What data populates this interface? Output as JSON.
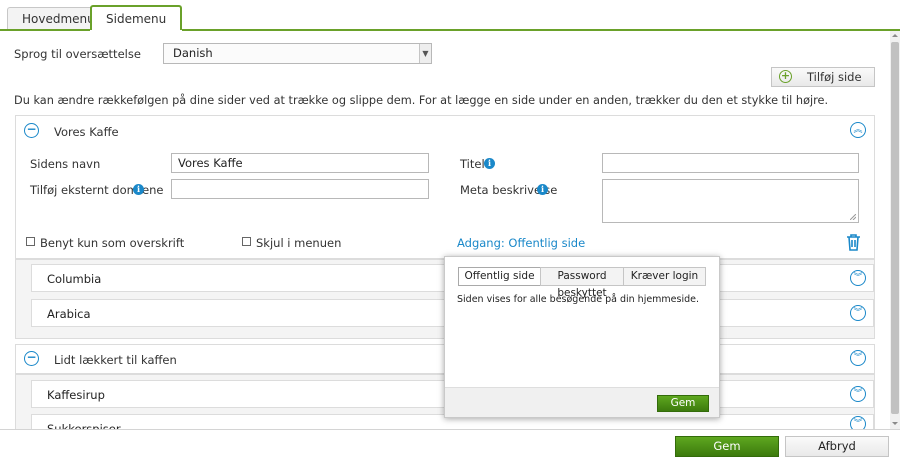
{
  "tabs": [
    {
      "label": "Hovedmenu",
      "active": false
    },
    {
      "label": "Sidemenu",
      "active": true
    }
  ],
  "language": {
    "label": "Sprog til oversættelse",
    "value": "Danish"
  },
  "add_page_button": "Tilføj side",
  "instructions": "Du kan ændre rækkefølgen på dine sider ved at trække og slippe dem. For at lægge en side under en anden, trækker du den et stykke til højre.",
  "page_panel": {
    "title": "Vores Kaffe",
    "fields": {
      "name_label": "Sidens navn",
      "name_value": "Vores Kaffe",
      "domain_label": "Tilføj eksternt domæne",
      "domain_value": "",
      "title_label": "Titel",
      "title_value": "",
      "meta_label": "Meta beskrivelse",
      "meta_value": ""
    },
    "checkbox_heading": "Benyt kun som overskrift",
    "checkbox_hide": "Skjul i menuen",
    "access_link": "Adgang: Offentlig side"
  },
  "subpages_1": [
    "Columbia",
    "Arabica"
  ],
  "second_panel": {
    "title": "Lidt lækkert til kaffen"
  },
  "subpages_2": [
    "Kaffesirup",
    "Sukkerspiser"
  ],
  "access_popup": {
    "options": [
      "Offentlig side",
      "Password beskyttet",
      "Kræver login"
    ],
    "selected": "Offentlig side",
    "description": "Siden vises for alle besøgende på din hjemmeside.",
    "save_label": "Gem"
  },
  "footer": {
    "save_label": "Gem",
    "cancel_label": "Afbryd"
  },
  "colors": {
    "accent_green": "#6aa12a",
    "link_blue": "#1a88c9"
  }
}
